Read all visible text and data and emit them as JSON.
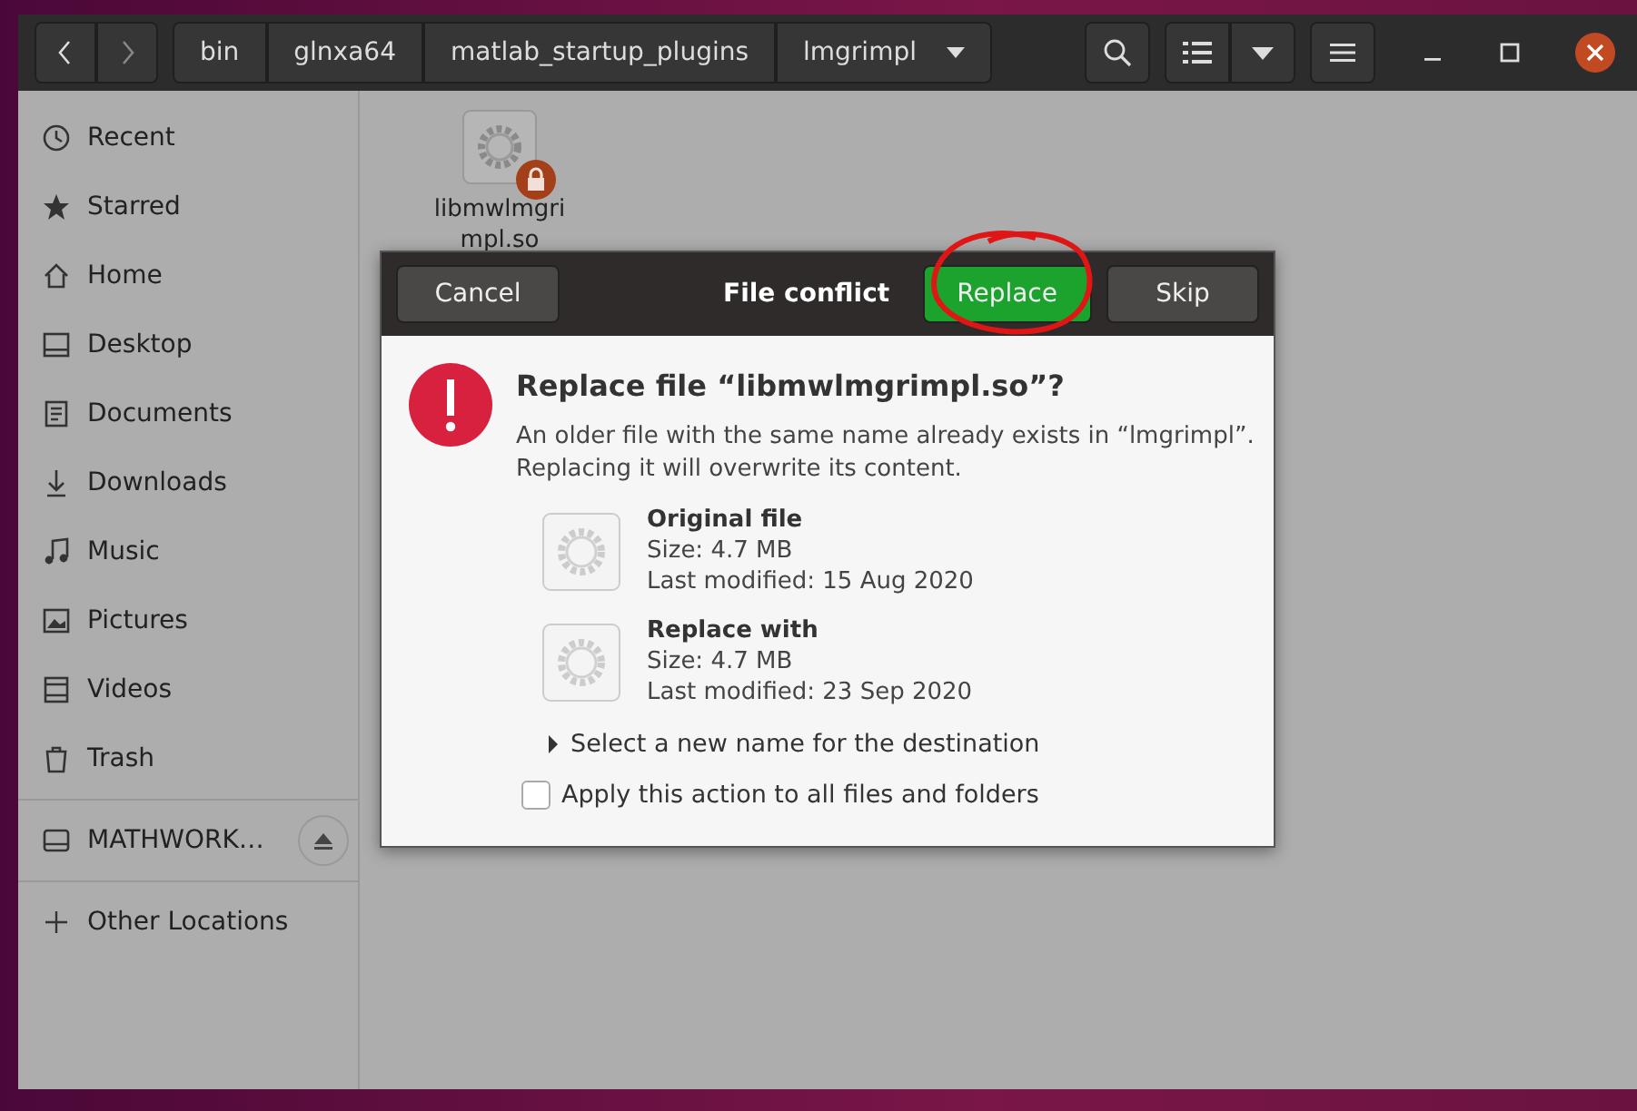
{
  "path_bar": {
    "segments": [
      "bin",
      "glnxa64",
      "matlab_startup_plugins",
      "lmgrimpl"
    ]
  },
  "sidebar": {
    "items": [
      {
        "label": "Recent"
      },
      {
        "label": "Starred"
      },
      {
        "label": "Home"
      },
      {
        "label": "Desktop"
      },
      {
        "label": "Documents"
      },
      {
        "label": "Downloads"
      },
      {
        "label": "Music"
      },
      {
        "label": "Pictures"
      },
      {
        "label": "Videos"
      },
      {
        "label": "Trash"
      }
    ],
    "devices": [
      {
        "label": "MATHWORK…"
      }
    ],
    "other": {
      "label": "Other Locations"
    }
  },
  "files": [
    {
      "name": "libmwlmgrimpl.so",
      "locked": true
    }
  ],
  "dialog": {
    "title": "File conflict",
    "cancel": "Cancel",
    "replace": "Replace",
    "skip": "Skip",
    "heading": "Replace file “libmwlmgrimpl.so”?",
    "message": "An older file with the same name already exists in “lmgrimpl”. Replacing it will overwrite its content.",
    "files": [
      {
        "title": "Original file",
        "size": "Size: 4.7 MB",
        "modified": "Last modified: 15 Aug 2020"
      },
      {
        "title": "Replace with",
        "size": "Size: 4.7 MB",
        "modified": "Last modified: 23 Sep 2020"
      }
    ],
    "rename": {
      "label": "Select a new name for the destination",
      "expanded": false
    },
    "apply_all": {
      "label": "Apply this action to all files and folders",
      "checked": false
    }
  }
}
